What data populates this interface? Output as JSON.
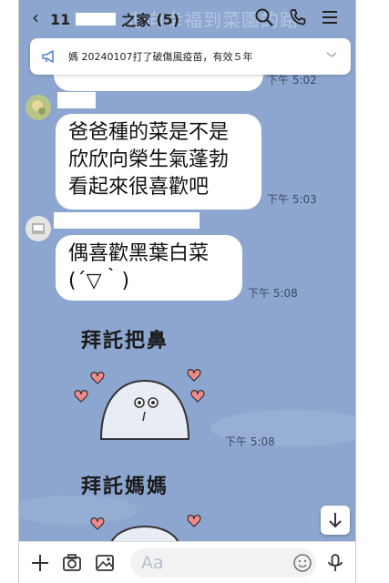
{
  "header": {
    "back_count": "11",
    "group_suffix": "之家",
    "member_count": "(5)",
    "ghost_title": "走向幸福到菜園的路"
  },
  "announcement": {
    "text": "媽 20240107打了破傷風疫苗，有效５年"
  },
  "messages": [
    {
      "text_lines": [
        "爸爸種的菜是不是",
        "欣欣向榮生氣蓬勃",
        "看起來很喜歡吧"
      ],
      "time": "下午 5:03"
    },
    {
      "text_lines": [
        "偶喜歡黑葉白菜",
        "(´▽｀)"
      ],
      "time": "下午 5:08"
    }
  ],
  "partial_top_time": "下午 5:02",
  "stickers": [
    {
      "caption": "拜託把鼻",
      "time": "下午 5:08"
    },
    {
      "caption": "拜託媽媽"
    }
  ],
  "input": {
    "placeholder": "Aa"
  },
  "colors": {
    "chat_bg": "#8da6cf",
    "bubble": "#ffffff"
  }
}
